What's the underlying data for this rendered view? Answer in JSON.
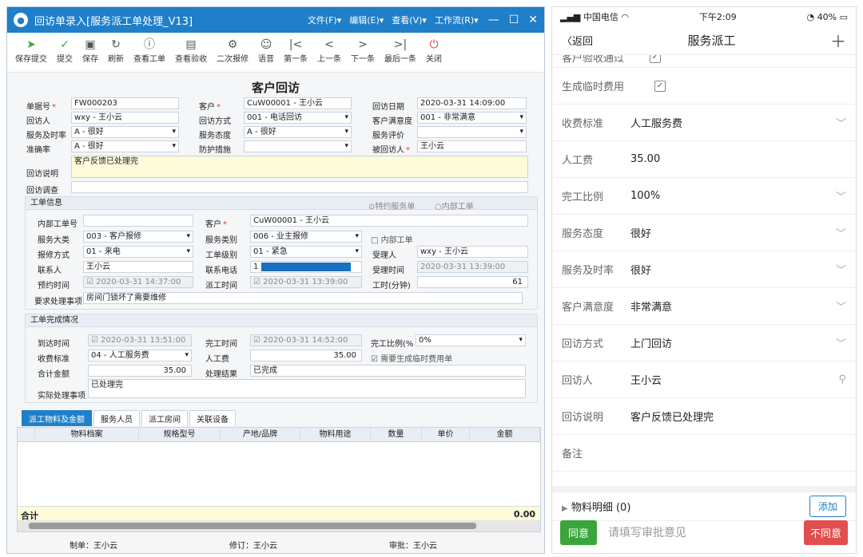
{
  "win": {
    "title": "回访单录入[服务派工单处理_V13]",
    "menus": [
      "文件(F)▾",
      "编辑(E)▾",
      "查看(V)▾",
      "工作流(R)▾"
    ],
    "toolbar": [
      {
        "label": "保存提交",
        "icon": "send-icon"
      },
      {
        "label": "提交",
        "icon": "check-circle-icon"
      },
      {
        "label": "保存",
        "icon": "save-icon"
      },
      {
        "label": "刷新",
        "icon": "refresh-icon"
      },
      {
        "label": "查看工单",
        "icon": "info-icon"
      },
      {
        "label": "查看验收",
        "icon": "document-icon"
      },
      {
        "label": "二次报修",
        "icon": "repair-icon"
      },
      {
        "label": "语音",
        "icon": "person-icon"
      },
      {
        "label": "第一条",
        "icon": "first-icon"
      },
      {
        "label": "上一条",
        "icon": "prev-icon"
      },
      {
        "label": "下一条",
        "icon": "next-icon"
      },
      {
        "label": "最后一条",
        "icon": "last-icon"
      },
      {
        "label": "关闭",
        "icon": "power-icon"
      }
    ],
    "form_title": "客户回访",
    "f": {
      "bill_no_l": "单据号",
      "bill_no": "FW000203",
      "cust_l": "客户",
      "cust": "CuW00001 - 王小云",
      "visit_date_l": "回访日期",
      "visit_date": "2020-03-31 14:09:00",
      "visitor_l": "回访人",
      "visitor": "wxy - 王小云",
      "method_l": "回访方式",
      "method": "001 - 电话回访",
      "satis_l": "客户满意度",
      "satis": "001 - 非常满意",
      "timely_l": "服务及时率",
      "timely": "A - 很好",
      "attitude_l": "服务态度",
      "attitude": "A - 很好",
      "eval_l": "服务评价",
      "eval": "",
      "accuracy_l": "准确率",
      "accuracy": "A - 很好",
      "protect_l": "防护措施",
      "protect": "",
      "visited_l": "被回访人",
      "visited": "王小云",
      "desc_l": "回访说明",
      "desc": "客户反馈已处理完",
      "survey_l": "回访调查",
      "survey": ""
    },
    "wo": {
      "header": "工单信息",
      "radio1": "⊙特约服务单",
      "radio2": "○内部工单",
      "inner_no_l": "内部工单号",
      "inner_no": "",
      "cust_l": "客户",
      "cust": "CuW00001 - 王小云",
      "cat_l": "服务大类",
      "cat": "003 - 客户报修",
      "type_l": "服务类别",
      "type": "006 - 业主报修",
      "inner_chk": "□ 内部工单",
      "report_l": "报修方式",
      "report": "01 - 来电",
      "level_l": "工单级别",
      "level": "01 - 紧急",
      "accepter_l": "受理人",
      "accepter": "wxy - 王小云",
      "contact_l": "联系人",
      "contact": "王小云",
      "phone_l": "联系电话",
      "phone": "1",
      "accept_time_l": "受理时间",
      "accept_time": "2020-03-31 13:39:00",
      "appoint_l": "预约时间",
      "appoint": "☑ 2020-03-31 14:37:00",
      "dispatch_l": "派工时间",
      "dispatch": "☑ 2020-03-31 13:39:00",
      "hours_l": "工时(分钟)",
      "hours": "61",
      "req_l": "要求处理事项",
      "req": "房间门锁坏了需要维修"
    },
    "done": {
      "header": "工单完成情况",
      "arrive_l": "到达时间",
      "arrive": "☑ 2020-03-31 13:51:00",
      "finish_l": "完工时间",
      "finish": "☑ 2020-03-31 14:52:00",
      "ratio_l": "完工比例(%",
      "ratio": "0%",
      "charge_l": "收费标准",
      "charge": "04 - 人工服务费",
      "labor_l": "人工费",
      "labor": "35.00",
      "temp_chk": "☑ 需要生成临时费用单",
      "total_l": "合计金额",
      "total": "35.00",
      "result_l": "处理结果",
      "result": "已完成",
      "actual_l": "实际处理事项",
      "actual": "已处理完"
    },
    "tabs": [
      "派工物料及金额",
      "服务人员",
      "派工房间",
      "关联设备"
    ],
    "grid_headers": [
      "物料档案",
      "规格型号",
      "产地/品牌",
      "物料用途",
      "数量",
      "单价",
      "金额"
    ],
    "grid_total_l": "合计",
    "grid_total": "0.00",
    "footer": {
      "maker": "制单：王小云",
      "editor": "修订：王小云",
      "approver": "审批：王小云"
    }
  },
  "phone": {
    "carrier": "中国电信",
    "time": "下午2:09",
    "battery": "40%",
    "back": "〈返回",
    "title": "服务派工",
    "top_partial": "客户验收通过",
    "rows": [
      {
        "k": "生成临时费用",
        "v": "",
        "type": "check"
      },
      {
        "k": "收费标准",
        "v": "人工服务费",
        "type": "dd"
      },
      {
        "k": "人工费",
        "v": "35.00",
        "type": "text"
      },
      {
        "k": "完工比例",
        "v": "100%",
        "type": "dd"
      },
      {
        "k": "服务态度",
        "v": "很好",
        "type": "dd"
      },
      {
        "k": "服务及时率",
        "v": "很好",
        "type": "dd"
      },
      {
        "k": "客户满意度",
        "v": "非常满意",
        "type": "dd"
      },
      {
        "k": "回访方式",
        "v": "上门回访",
        "type": "dd"
      },
      {
        "k": "回访人",
        "v": "王小云",
        "type": "search"
      },
      {
        "k": "回访说明",
        "v": "客户反馈已处理完",
        "type": "text"
      },
      {
        "k": "备注",
        "v": "",
        "type": "text"
      }
    ],
    "detail": "物料明细 (0)",
    "add": "添加",
    "agree": "同意",
    "placeholder": "请填写审批意见",
    "disagree": "不同意"
  }
}
